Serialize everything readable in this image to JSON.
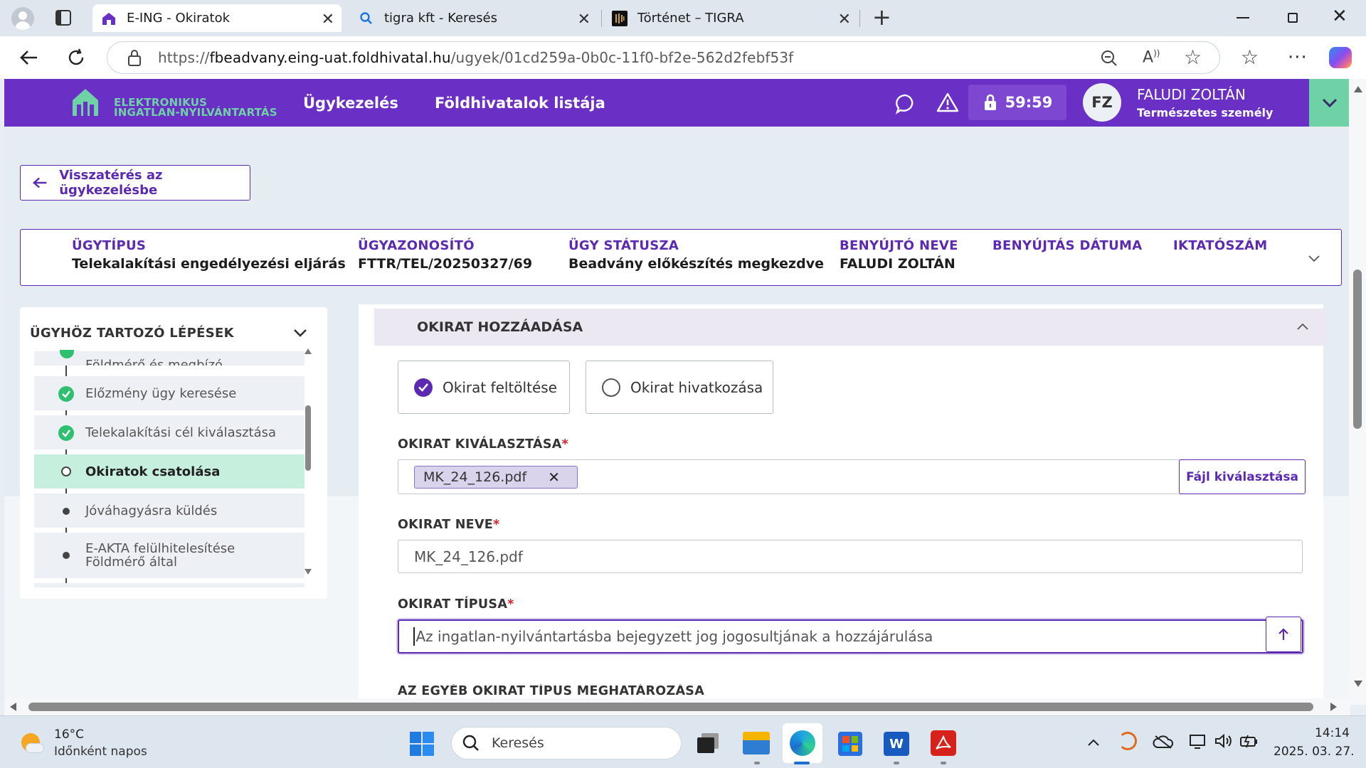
{
  "browser": {
    "tabs": [
      {
        "label": "E-ING - Okiratok"
      },
      {
        "label": "tigra kft - Keresés"
      },
      {
        "label": "Történet – TIGRA"
      }
    ],
    "url_prefix": "https://",
    "url_domain": "fbeadvany.eing-uat.foldhivatal.hu",
    "url_path": "/ugyek/01cd259a-0b0c-11f0-bf2e-562d2febf53f"
  },
  "header": {
    "brand_line1": "ELEKTRONIKUS",
    "brand_line2": "INGATLAN-NYILVÁNTARTÁS",
    "nav": [
      "Ügykezelés",
      "Földhivatalok listája"
    ],
    "timer": "59:59",
    "user_initials": "FZ",
    "user_name": "FALUDI ZOLTÁN",
    "user_type": "Természetes személy",
    "brand_color": "#6a2fc4",
    "accent_color": "#6fd1a6"
  },
  "back_button": "Visszatérés az ügykezelésbe",
  "case_info": {
    "columns": [
      {
        "label": "ÜGYTÍPUS",
        "value": "Telekalakítási engedélyezési eljárás"
      },
      {
        "label": "ÜGYAZONOSÍTÓ",
        "value": "FTTR/TEL/20250327/69"
      },
      {
        "label": "ÜGY STÁTUSZA",
        "value": "Beadvány előkészítés megkezdve"
      },
      {
        "label": "BENYÚJTÓ NEVE",
        "value": "FALUDI ZOLTÁN"
      },
      {
        "label": "BENYÚJTÁS DÁTUMA",
        "value": ""
      },
      {
        "label": "IKTATÓSZÁM",
        "value": ""
      }
    ]
  },
  "steps": {
    "title": "ÜGYHÖZ TARTOZÓ LÉPÉSEK",
    "items": [
      {
        "label": "Földmérő és megbízó",
        "status": "done"
      },
      {
        "label": "Előzmény ügy keresése",
        "status": "done"
      },
      {
        "label": "Telekalakítási cél kiválasztása",
        "status": "done"
      },
      {
        "label": "Okiratok csatolása",
        "status": "current"
      },
      {
        "label": "Jóváhagyásra küldés",
        "status": "pending"
      },
      {
        "label": "E-AKTA felülhitelesítése",
        "label2": "Földmérő által",
        "status": "pending"
      }
    ]
  },
  "form": {
    "section_title": "OKIRAT HOZZÁADÁSA",
    "options": [
      {
        "label": "Okirat feltöltése",
        "checked": true
      },
      {
        "label": "Okirat hivatkozása",
        "checked": false
      }
    ],
    "file_label": "OKIRAT KIVÁLASZTÁSA",
    "file_chip": "MK_24_126.pdf",
    "file_button": "Fájl kiválasztása",
    "name_label": "OKIRAT NEVE",
    "name_value": "MK_24_126.pdf",
    "type_label": "OKIRAT TÍPUSA",
    "type_value": "Az ingatlan-nyilvántartásba bejegyzett jog jogosultjának a hozzájárulása",
    "other_label": "AZ EGYÉB OKIRAT TÍPUS MEGHATÁROZÁSA",
    "required_mark": "*"
  },
  "taskbar": {
    "weather_temp": "16°C",
    "weather_desc": "Időnként napos",
    "search_placeholder": "Keresés",
    "time": "14:14",
    "date": "2025. 03. 27."
  }
}
